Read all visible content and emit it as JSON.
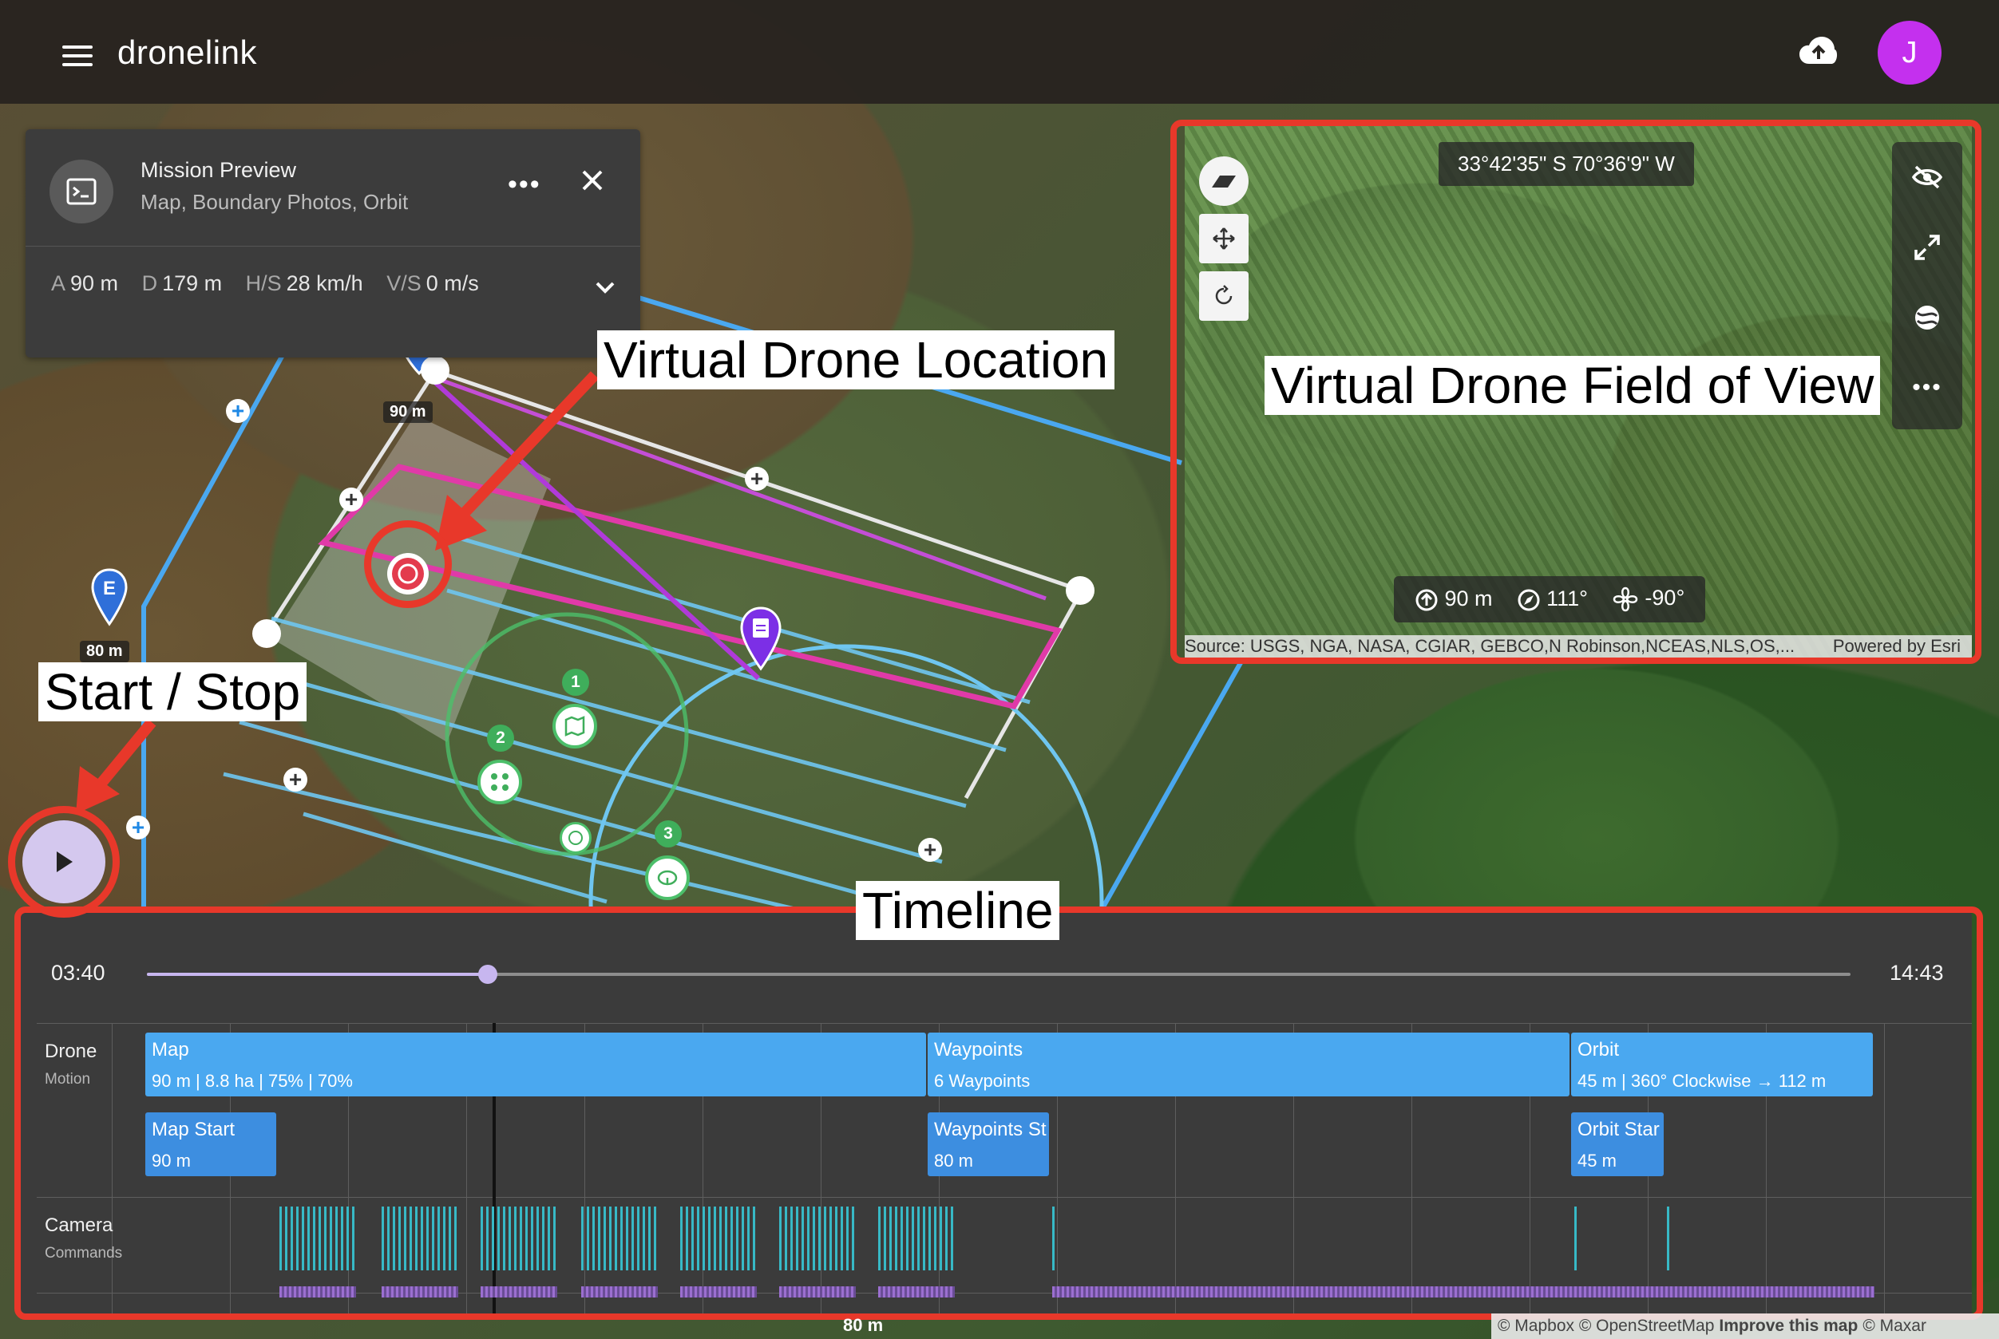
{
  "app": {
    "brand": "dronelink",
    "avatar_letter": "J"
  },
  "mission": {
    "title": "Mission Preview",
    "subtitle": "Map, Boundary Photos, Orbit",
    "stats": [
      {
        "label": "A",
        "value": "90 m"
      },
      {
        "label": "D",
        "value": "179 m"
      },
      {
        "label": "H/S",
        "value": "28 km/h"
      },
      {
        "label": "V/S",
        "value": "0 m/s"
      }
    ]
  },
  "map": {
    "pin_start_alt": "90 m",
    "pin_end_letter": "E",
    "pin_end_alt": "80 m",
    "waypoint_numbers": [
      "1",
      "2",
      "3"
    ],
    "scale_label": "80 m",
    "attribution": "© Mapbox © OpenStreetMap",
    "attribution_bold": "Improve this map",
    "attribution_end": "© Maxar"
  },
  "fov": {
    "coords": "33°42'35\" S 70°36'9\" W",
    "altitude": "90 m",
    "heading": "111°",
    "gimbal": "-90°",
    "source": "Source: USGS, NGA, NASA, CGIAR, GEBCO,N Robinson,NCEAS,NLS,OS,...",
    "powered": "Powered by Esri"
  },
  "timeline": {
    "elapsed": "03:40",
    "total": "14:43",
    "progress": 0.2,
    "rows": [
      {
        "title": "Drone",
        "subtitle": "Motion"
      },
      {
        "title": "Camera",
        "subtitle": "Commands"
      }
    ],
    "blocks": [
      {
        "title": "Map",
        "detail": "90 m | 8.8 ha | 75% | 70%"
      },
      {
        "title": "Waypoints",
        "detail": "6 Waypoints"
      },
      {
        "title": "Orbit",
        "detail": "45 m | 360° Clockwise → 112 m"
      }
    ],
    "sub_blocks": [
      {
        "title": "Map Start",
        "detail": "90 m"
      },
      {
        "title": "Waypoints St",
        "detail": "80 m"
      },
      {
        "title": "Orbit Star",
        "detail": "45 m"
      }
    ]
  },
  "annotations": {
    "drone_location": "Virtual Drone Location",
    "field_of_view": "Virtual Drone Field of View",
    "start_stop": "Start / Stop",
    "timeline": "Timeline"
  },
  "colors": {
    "accent": "#c430ee",
    "annotation_red": "#e8382a",
    "timeline_block": "#4aa8f0",
    "track": "#c7b6ef"
  }
}
